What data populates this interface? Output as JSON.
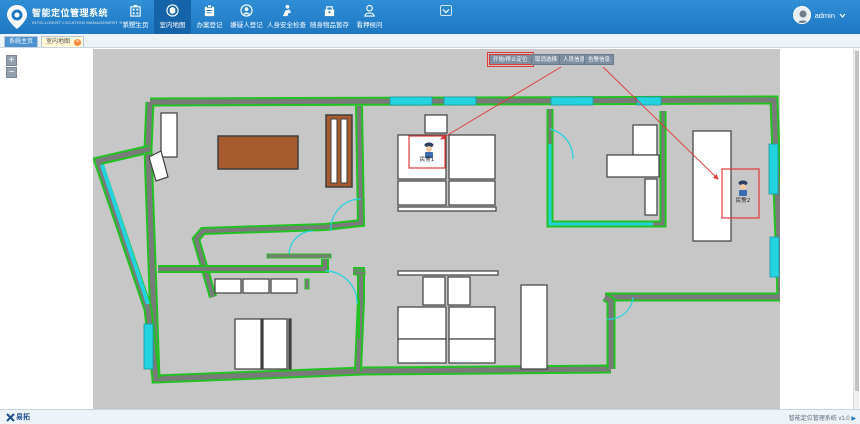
{
  "brand": {
    "title": "智能定位管理系统",
    "subtitle": "INTELLIGENT LOCATION MANAGEMENT SYSTEM"
  },
  "nav": [
    {
      "label": "系统主页",
      "icon": "building-icon"
    },
    {
      "label": "室内地图",
      "icon": "map-pin-icon"
    },
    {
      "label": "办案登记",
      "icon": "clipboard-icon"
    },
    {
      "label": "嫌疑人登记",
      "icon": "suspect-icon"
    },
    {
      "label": "人身安全检查",
      "icon": "security-check-icon"
    },
    {
      "label": "随身物品暂存",
      "icon": "storage-icon"
    },
    {
      "label": "看押候问",
      "icon": "guard-icon"
    }
  ],
  "user": {
    "name": "admin"
  },
  "tabs": {
    "home": "系统主页",
    "map": "室内地图",
    "close": "×"
  },
  "zoom": {
    "in": "+",
    "out": "−"
  },
  "toolbar": {
    "start_stop": "开始/停止定位",
    "cancel_select": "取消选择",
    "person_info": "人员信息",
    "alarm_info": "告警信息"
  },
  "markers": [
    {
      "label": "民警1"
    },
    {
      "label": "民警2"
    }
  ],
  "footer": {
    "logo": "易拓",
    "version": "智能定位管理系统 v1.0"
  },
  "colors": {
    "header": "#1e78c2",
    "wall": "#7a7a7a",
    "wall_outline": "#22c222",
    "window": "#23d3e0",
    "table": "#a65a2e",
    "highlight": "#e03a3a"
  }
}
